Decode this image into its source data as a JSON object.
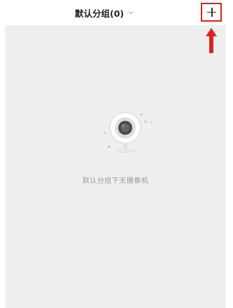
{
  "header": {
    "group_title": "默认分组(0)",
    "dropdown_icon": "chevron-down-icon",
    "add_button_label": "+",
    "highlight_color": "#d9231f"
  },
  "empty_state": {
    "icon": "camera-icon",
    "message": "默认分组下无摄像机"
  }
}
